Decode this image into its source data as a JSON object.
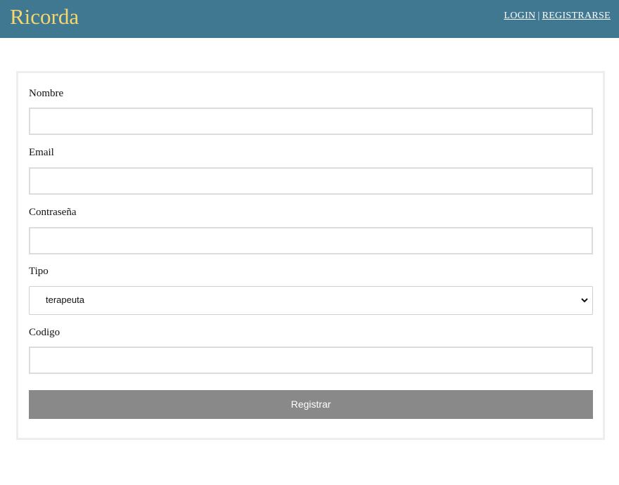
{
  "header": {
    "brand": "Ricorda",
    "nav": {
      "login": "LOGIN",
      "separator": "|",
      "register": "REGISTRARSE"
    }
  },
  "form": {
    "nombre": {
      "label": "Nombre",
      "value": ""
    },
    "email": {
      "label": "Email",
      "value": ""
    },
    "password": {
      "label": "Contraseña",
      "value": ""
    },
    "tipo": {
      "label": "Tipo",
      "selected": "terapeuta"
    },
    "codigo": {
      "label": "Codigo",
      "value": ""
    },
    "submit_label": "Registrar"
  },
  "colors": {
    "header_bg": "#407791",
    "brand": "#f5d76e",
    "button_bg": "#898989"
  },
  "icons": {
    "select_chevron": "chevron-down-icon"
  }
}
